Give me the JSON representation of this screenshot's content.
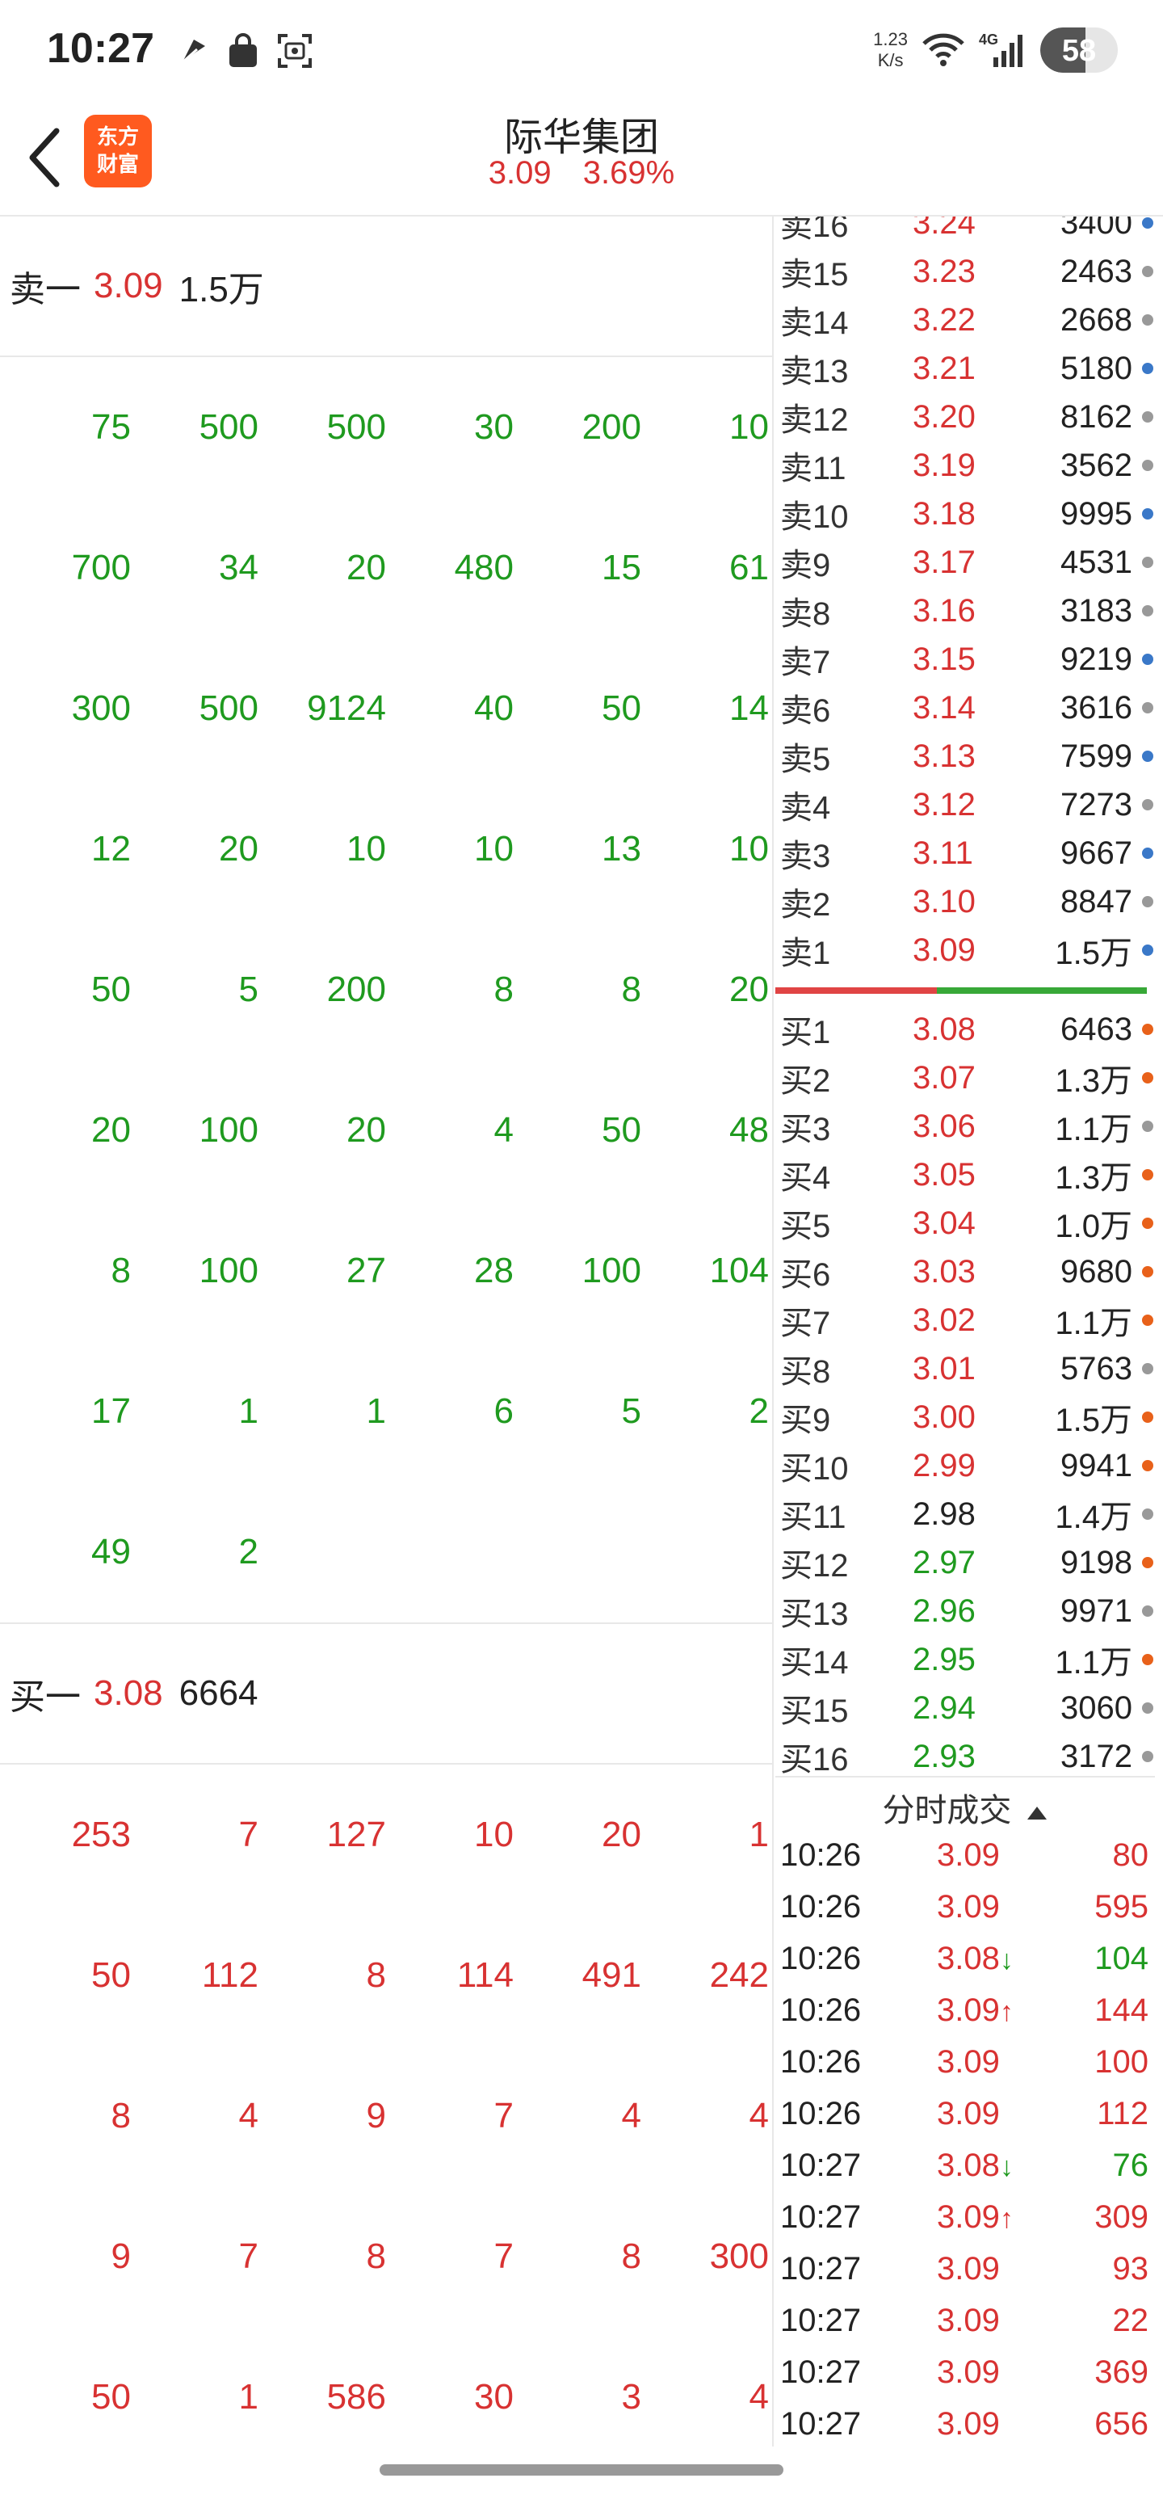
{
  "status_bar": {
    "time": "10:27",
    "net_speed_value": "1.23",
    "net_speed_unit": "K/s",
    "network": "4G",
    "battery": "58",
    "battery_level": 0.58
  },
  "header": {
    "title": "际华集团",
    "price": "3.09",
    "change_pct": "3.69%",
    "logo_line1": "东方",
    "logo_line2": "财富"
  },
  "sell_summary": {
    "label": "卖一",
    "price": "3.09",
    "volume": "1.5万"
  },
  "sell_orders": [
    [
      "75",
      "500",
      "500",
      "30",
      "200",
      "10"
    ],
    [
      "700",
      "34",
      "20",
      "480",
      "15",
      "61"
    ],
    [
      "300",
      "500",
      "9124",
      "40",
      "50",
      "14"
    ],
    [
      "12",
      "20",
      "10",
      "10",
      "13",
      "10"
    ],
    [
      "50",
      "5",
      "200",
      "8",
      "8",
      "20"
    ],
    [
      "20",
      "100",
      "20",
      "4",
      "50",
      "48"
    ],
    [
      "8",
      "100",
      "27",
      "28",
      "100",
      "104"
    ],
    [
      "17",
      "1",
      "1",
      "6",
      "5",
      "2"
    ],
    [
      "49",
      "2",
      "",
      "",
      "",
      ""
    ]
  ],
  "buy_summary": {
    "label": "买一",
    "price": "3.08",
    "volume": "6664"
  },
  "buy_orders": [
    [
      "253",
      "7",
      "127",
      "10",
      "20",
      "1"
    ],
    [
      "50",
      "112",
      "8",
      "114",
      "491",
      "242"
    ],
    [
      "8",
      "4",
      "9",
      "7",
      "4",
      "4"
    ],
    [
      "9",
      "7",
      "8",
      "7",
      "8",
      "300"
    ],
    [
      "50",
      "1",
      "586",
      "30",
      "3",
      "4"
    ]
  ],
  "order_book": {
    "asks": [
      {
        "label": "卖16",
        "price": "3.24",
        "volume": "3400",
        "color": "red",
        "dot": "blue"
      },
      {
        "label": "卖15",
        "price": "3.23",
        "volume": "2463",
        "color": "red",
        "dot": "grey"
      },
      {
        "label": "卖14",
        "price": "3.22",
        "volume": "2668",
        "color": "red",
        "dot": "grey"
      },
      {
        "label": "卖13",
        "price": "3.21",
        "volume": "5180",
        "color": "red",
        "dot": "blue"
      },
      {
        "label": "卖12",
        "price": "3.20",
        "volume": "8162",
        "color": "red",
        "dot": "grey"
      },
      {
        "label": "卖11",
        "price": "3.19",
        "volume": "3562",
        "color": "red",
        "dot": "grey"
      },
      {
        "label": "卖10",
        "price": "3.18",
        "volume": "9995",
        "color": "red",
        "dot": "blue"
      },
      {
        "label": "卖9",
        "price": "3.17",
        "volume": "4531",
        "color": "red",
        "dot": "grey"
      },
      {
        "label": "卖8",
        "price": "3.16",
        "volume": "3183",
        "color": "red",
        "dot": "grey"
      },
      {
        "label": "卖7",
        "price": "3.15",
        "volume": "9219",
        "color": "red",
        "dot": "blue"
      },
      {
        "label": "卖6",
        "price": "3.14",
        "volume": "3616",
        "color": "red",
        "dot": "grey"
      },
      {
        "label": "卖5",
        "price": "3.13",
        "volume": "7599",
        "color": "red",
        "dot": "blue"
      },
      {
        "label": "卖4",
        "price": "3.12",
        "volume": "7273",
        "color": "red",
        "dot": "grey"
      },
      {
        "label": "卖3",
        "price": "3.11",
        "volume": "9667",
        "color": "red",
        "dot": "blue"
      },
      {
        "label": "卖2",
        "price": "3.10",
        "volume": "8847",
        "color": "red",
        "dot": "grey"
      },
      {
        "label": "卖1",
        "price": "3.09",
        "volume": "1.5万",
        "color": "red",
        "dot": "blue"
      }
    ],
    "bids": [
      {
        "label": "买1",
        "price": "3.08",
        "volume": "6463",
        "color": "red",
        "dot": "orange"
      },
      {
        "label": "买2",
        "price": "3.07",
        "volume": "1.3万",
        "color": "red",
        "dot": "orange"
      },
      {
        "label": "买3",
        "price": "3.06",
        "volume": "1.1万",
        "color": "red",
        "dot": "grey"
      },
      {
        "label": "买4",
        "price": "3.05",
        "volume": "1.3万",
        "color": "red",
        "dot": "orange"
      },
      {
        "label": "买5",
        "price": "3.04",
        "volume": "1.0万",
        "color": "red",
        "dot": "orange"
      },
      {
        "label": "买6",
        "price": "3.03",
        "volume": "9680",
        "color": "red",
        "dot": "orange"
      },
      {
        "label": "买7",
        "price": "3.02",
        "volume": "1.1万",
        "color": "red",
        "dot": "orange"
      },
      {
        "label": "买8",
        "price": "3.01",
        "volume": "5763",
        "color": "red",
        "dot": "grey"
      },
      {
        "label": "买9",
        "price": "3.00",
        "volume": "1.5万",
        "color": "red",
        "dot": "orange"
      },
      {
        "label": "买10",
        "price": "2.99",
        "volume": "9941",
        "color": "red",
        "dot": "orange"
      },
      {
        "label": "买11",
        "price": "2.98",
        "volume": "1.4万",
        "color": "dark",
        "dot": "grey"
      },
      {
        "label": "买12",
        "price": "2.97",
        "volume": "9198",
        "color": "green",
        "dot": "orange"
      },
      {
        "label": "买13",
        "price": "2.96",
        "volume": "9971",
        "color": "green",
        "dot": "grey"
      },
      {
        "label": "买14",
        "price": "2.95",
        "volume": "1.1万",
        "color": "green",
        "dot": "orange"
      },
      {
        "label": "买15",
        "price": "2.94",
        "volume": "3060",
        "color": "green",
        "dot": "grey"
      },
      {
        "label": "买16",
        "price": "2.93",
        "volume": "3172",
        "color": "green",
        "dot": "grey"
      }
    ]
  },
  "trades": {
    "title": "分时成交",
    "rows": [
      {
        "time": "10:26",
        "price": "3.09",
        "arrow": "",
        "volume": "80",
        "vcolor": "red"
      },
      {
        "time": "10:26",
        "price": "3.09",
        "arrow": "",
        "volume": "595",
        "vcolor": "red"
      },
      {
        "time": "10:26",
        "price": "3.08",
        "arrow": "↓",
        "volume": "104",
        "vcolor": "green"
      },
      {
        "time": "10:26",
        "price": "3.09",
        "arrow": "↑",
        "volume": "144",
        "vcolor": "red"
      },
      {
        "time": "10:26",
        "price": "3.09",
        "arrow": "",
        "volume": "100",
        "vcolor": "red"
      },
      {
        "time": "10:26",
        "price": "3.09",
        "arrow": "",
        "volume": "112",
        "vcolor": "red"
      },
      {
        "time": "10:27",
        "price": "3.08",
        "arrow": "↓",
        "volume": "76",
        "vcolor": "green"
      },
      {
        "time": "10:27",
        "price": "3.09",
        "arrow": "↑",
        "volume": "309",
        "vcolor": "red"
      },
      {
        "time": "10:27",
        "price": "3.09",
        "arrow": "",
        "volume": "93",
        "vcolor": "red"
      },
      {
        "time": "10:27",
        "price": "3.09",
        "arrow": "",
        "volume": "22",
        "vcolor": "red"
      },
      {
        "time": "10:27",
        "price": "3.09",
        "arrow": "",
        "volume": "369",
        "vcolor": "red"
      },
      {
        "time": "10:27",
        "price": "3.09",
        "arrow": "",
        "volume": "656",
        "vcolor": "red"
      }
    ]
  },
  "colors": {
    "up": "#d83232",
    "down": "#1f9a1f",
    "brand": "#ff5a1f"
  }
}
